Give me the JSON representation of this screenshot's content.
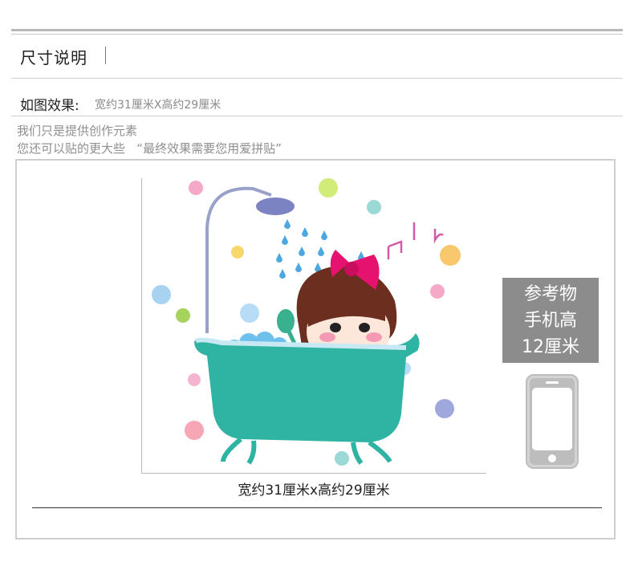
{
  "header": {
    "title": "尺寸说明"
  },
  "effect": {
    "label": "如图效果:",
    "value": "宽约31厘米X高约29厘米"
  },
  "notes": [
    "我们只是提供创作元素",
    "您还可以贴的更大些   “最终效果需要您用爱拼贴”"
  ],
  "caption": "宽约31厘米x高约29厘米",
  "reference": {
    "line1": "参考物",
    "line2": "手机高",
    "line3": "12厘米"
  },
  "icons": [
    "phone-icon"
  ],
  "colors": {
    "tub": "#2fb3a3",
    "bow": "#e6126f",
    "ref_box": "#8c8c8c"
  }
}
